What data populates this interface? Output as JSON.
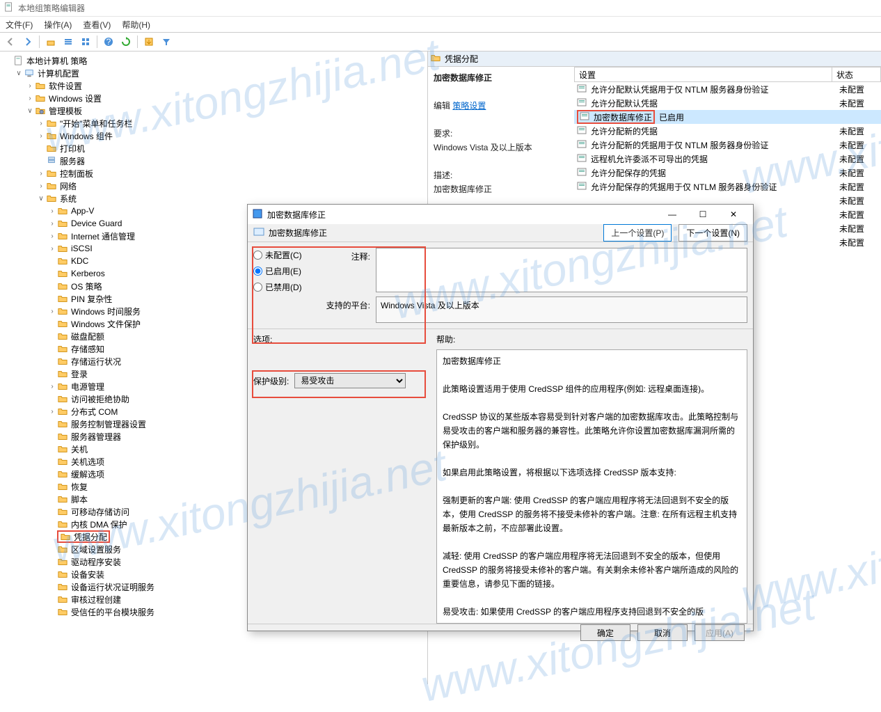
{
  "window": {
    "title": "本地组策略编辑器"
  },
  "menus": {
    "file": "文件(F)",
    "action": "操作(A)",
    "view": "查看(V)",
    "help": "帮助(H)"
  },
  "tree": {
    "root": "本地计算机 策略",
    "computer_cfg": "计算机配置",
    "software": "软件设置",
    "windows_settings": "Windows 设置",
    "admin_templates": "管理模板",
    "start_taskbar": "\"开始\"菜单和任务栏",
    "win_components": "Windows 组件",
    "printers": "打印机",
    "servers": "服务器",
    "control_panel": "控制面板",
    "network": "网络",
    "system": "系统",
    "sys_children": [
      "App-V",
      "Device Guard",
      "Internet 通信管理",
      "iSCSI",
      "KDC",
      "Kerberos",
      "OS 策略",
      "PIN 复杂性",
      "Windows 时间服务",
      "Windows 文件保护",
      "磁盘配额",
      "存储感知",
      "存储运行状况",
      "登录",
      "电源管理",
      "访问被拒绝协助",
      "分布式 COM",
      "服务控制管理器设置",
      "服务器管理器",
      "关机",
      "关机选项",
      "缓解选项",
      "恢复",
      "脚本",
      "可移动存储访问",
      "内核 DMA 保护"
    ],
    "cred_delegation": "凭据分配",
    "sys_after": [
      "区域设置服务",
      "驱动程序安装",
      "设备安装",
      "设备运行状况证明服务",
      "审核过程创建",
      "受信任的平台模块服务"
    ]
  },
  "detail": {
    "header": "凭据分配",
    "left": {
      "title": "加密数据库修正",
      "edit_label": "编辑",
      "edit_link": "策略设置",
      "req_label": "要求:",
      "req_value": "Windows Vista 及以上版本",
      "desc_label": "描述:",
      "desc_value": "加密数据库修正",
      "note1": "此策略设置适用于使用 CredSSP 组件的应用程序(例如: 远程桌面连接)。"
    },
    "cols": {
      "setting": "设置",
      "state": "状态"
    },
    "rows": [
      {
        "name": "允许分配默认凭据用于仅 NTLM 服务器身份验证",
        "state": "未配置"
      },
      {
        "name": "允许分配默认凭据",
        "state": "未配置"
      },
      {
        "name": "加密数据库修正",
        "state": "已启用",
        "selected": true
      },
      {
        "name": "允许分配新的凭据",
        "state": "未配置"
      },
      {
        "name": "允许分配新的凭据用于仅 NTLM 服务器身份验证",
        "state": "未配置"
      },
      {
        "name": "远程机允许委派不可导出的凭据",
        "state": "未配置"
      },
      {
        "name": "允许分配保存的凭据",
        "state": "未配置"
      },
      {
        "name": "允许分配保存的凭据用于仅 NTLM 服务器身份验证",
        "state": "未配置"
      },
      {
        "name": "",
        "state": "未配置"
      },
      {
        "name": "",
        "state": "未配置"
      },
      {
        "name": "",
        "state": "未配置"
      },
      {
        "name": "",
        "state": "未配置"
      }
    ]
  },
  "dialog": {
    "title": "加密数据库修正",
    "subtitle": "加密数据库修正",
    "prev": "上一个设置(P)",
    "next": "下一个设置(N)",
    "radio_notconf": "未配置(C)",
    "radio_enabled": "已启用(E)",
    "radio_disabled": "已禁用(D)",
    "comment_label": "注释:",
    "comment_value": "",
    "supported_label": "支持的平台:",
    "supported_value": "Windows Vista 及以上版本",
    "options_label": "选项:",
    "help_label": "帮助:",
    "protect_label": "保护级别:",
    "protect_value": "易受攻击",
    "help_text_1": "加密数据库修正",
    "help_text_2": "此策略设置适用于使用 CredSSP 组件的应用程序(例如: 远程桌面连接)。",
    "help_text_3": "CredSSP 协议的某些版本容易受到针对客户端的加密数据库攻击。此策略控制与易受攻击的客户端和服务器的兼容性。此策略允许你设置加密数据库漏洞所需的保护级别。",
    "help_text_4": "如果启用此策略设置，将根据以下选项选择 CredSSP 版本支持:",
    "help_text_5": "强制更新的客户端: 使用 CredSSP 的客户端应用程序将无法回退到不安全的版本，使用 CredSSP 的服务将不接受未修补的客户端。注意: 在所有远程主机支持最新版本之前，不应部署此设置。",
    "help_text_6": "减轻: 使用 CredSSP 的客户端应用程序将无法回退到不安全的版本，但使用 CredSSP 的服务将接受未修补的客户端。有关剩余未修补客户端所造成的风险的重要信息，请参见下面的链接。",
    "help_text_7": "易受攻击: 如果使用 CredSSP 的客户端应用程序支持回退到不安全的版",
    "ok": "确定",
    "cancel": "取消",
    "apply": "应用(A)"
  },
  "watermark": "www.xitongzhijia.net"
}
